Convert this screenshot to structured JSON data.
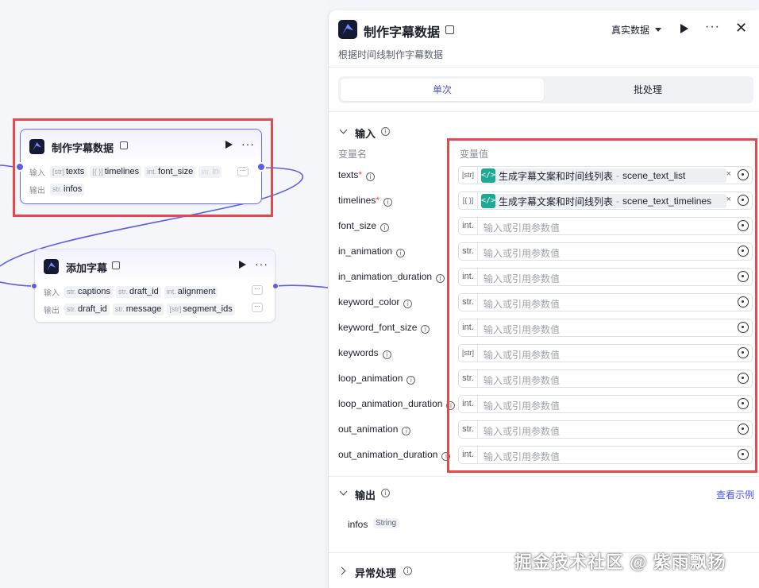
{
  "colors": {
    "accent": "#4d53e8",
    "port": "#5b5fe8",
    "highlight": "#e5484d",
    "ref_icon": "#1ea896"
  },
  "canvas": {
    "node1": {
      "title": "制作字幕数据",
      "input_label": "输入",
      "output_label": "输出",
      "inputs": [
        {
          "type": "[str]",
          "name": "texts"
        },
        {
          "type": "[{ }]",
          "name": "timelines"
        },
        {
          "type": "int.",
          "name": "font_size"
        },
        {
          "type": "str.",
          "name": "in"
        }
      ],
      "outputs": [
        {
          "type": "str.",
          "name": "infos"
        }
      ],
      "more": "···"
    },
    "node2": {
      "title": "添加字幕",
      "input_label": "输入",
      "output_label": "输出",
      "inputs": [
        {
          "type": "str.",
          "name": "captions"
        },
        {
          "type": "str.",
          "name": "draft_id"
        },
        {
          "type": "int.",
          "name": "alignment"
        }
      ],
      "outputs": [
        {
          "type": "str.",
          "name": "draft_id"
        },
        {
          "type": "str.",
          "name": "message"
        },
        {
          "type": "[str]",
          "name": "segment_ids"
        }
      ],
      "more": "···"
    }
  },
  "panel": {
    "title": "制作字幕数据",
    "description": "根据时间线制作字幕数据",
    "mode": "真实数据",
    "more": "···",
    "close": "✕",
    "tabs": [
      {
        "label": "单次",
        "active": true
      },
      {
        "label": "批处理",
        "active": false
      }
    ],
    "input_section": {
      "title": "输入",
      "col_name": "变量名",
      "col_value": "变量值",
      "params": [
        {
          "name": "texts",
          "required": true,
          "type": "[str]",
          "ref": {
            "source": "生成字幕文案和时间线列表",
            "sep": "-",
            "var": "scene_text_list"
          }
        },
        {
          "name": "timelines",
          "required": true,
          "type": "[{ }]",
          "ref": {
            "source": "生成字幕文案和时间线列表",
            "sep": "-",
            "var": "scene_text_timelines"
          }
        },
        {
          "name": "font_size",
          "type": "int.",
          "placeholder": "输入或引用参数值"
        },
        {
          "name": "in_animation",
          "type": "str.",
          "placeholder": "输入或引用参数值"
        },
        {
          "name": "in_animation_duration",
          "type": "int.",
          "placeholder": "输入或引用参数值"
        },
        {
          "name": "keyword_color",
          "type": "str.",
          "placeholder": "输入或引用参数值"
        },
        {
          "name": "keyword_font_size",
          "type": "int.",
          "placeholder": "输入或引用参数值"
        },
        {
          "name": "keywords",
          "type": "[str]",
          "placeholder": "输入或引用参数值"
        },
        {
          "name": "loop_animation",
          "type": "str.",
          "placeholder": "输入或引用参数值"
        },
        {
          "name": "loop_animation_duration",
          "type": "int.",
          "placeholder": "输入或引用参数值"
        },
        {
          "name": "out_animation",
          "type": "str.",
          "placeholder": "输入或引用参数值"
        },
        {
          "name": "out_animation_duration",
          "type": "int.",
          "placeholder": "输入或引用参数值"
        }
      ]
    },
    "output_section": {
      "title": "输出",
      "view_example": "查看示例",
      "items": [
        {
          "name": "infos",
          "type": "String"
        }
      ]
    },
    "exception_section": {
      "title": "异常处理"
    }
  },
  "watermark": "掘金技术社区 @ 紫雨飘扬"
}
